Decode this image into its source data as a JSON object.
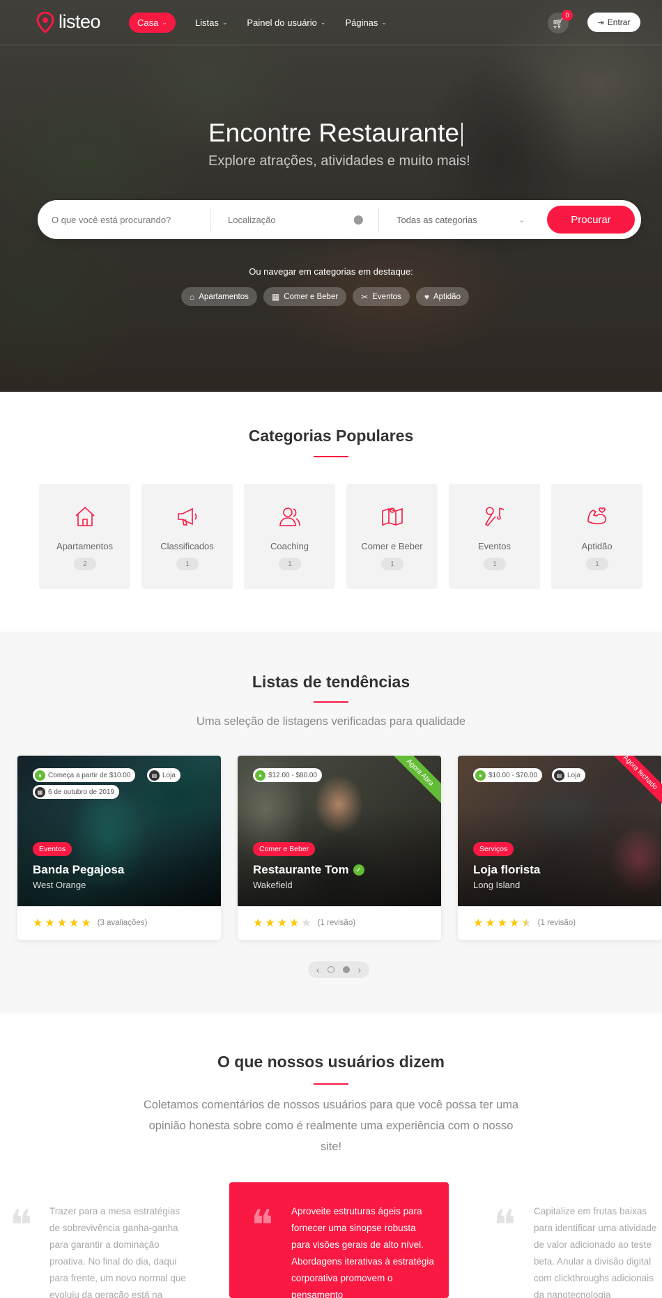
{
  "brand": {
    "name": "listeo",
    "accent": "#f91942"
  },
  "nav": {
    "items": [
      {
        "label": "Casa",
        "active": true
      },
      {
        "label": "Listas",
        "active": false
      },
      {
        "label": "Painel do usuário",
        "active": false
      },
      {
        "label": "Páginas",
        "active": false
      }
    ],
    "cart_count": "0",
    "signin_label": "Entrar"
  },
  "hero": {
    "title": "Encontre Restaurante",
    "subtitle": "Explore atrações, atividades e muito mais!",
    "search": {
      "what_placeholder": "O que você está procurando?",
      "location_placeholder": "Localização",
      "category_value": "Todas as categorias",
      "button_label": "Procurar"
    },
    "browse_label": "Ou navegar em categorias em destaque:",
    "featured": [
      {
        "label": "Apartamentos",
        "icon": "house-icon"
      },
      {
        "label": "Comer e Beber",
        "icon": "food-icon"
      },
      {
        "label": "Eventos",
        "icon": "tools-icon"
      },
      {
        "label": "Aptidão",
        "icon": "fitness-icon"
      }
    ]
  },
  "popular": {
    "title": "Categorias Populares",
    "items": [
      {
        "name": "Apartamentos",
        "count": "2",
        "icon": "house-icon"
      },
      {
        "name": "Classificados",
        "count": "1",
        "icon": "megaphone-icon"
      },
      {
        "name": "Coaching",
        "count": "1",
        "icon": "people-icon"
      },
      {
        "name": "Comer e Beber",
        "count": "1",
        "icon": "map-icon"
      },
      {
        "name": "Eventos",
        "count": "1",
        "icon": "microphone-icon"
      },
      {
        "name": "Aptidão",
        "count": "1",
        "icon": "muscle-icon"
      }
    ]
  },
  "trending": {
    "title": "Listas de tendências",
    "subtitle": "Uma seleção de listagens verificadas para qualidade",
    "cards": [
      {
        "price": "Começa a partir de $10.00",
        "store": "Loja",
        "date": "6 de outubro de 2019",
        "type": "Eventos",
        "title": "Banda Pegajosa",
        "location": "West Orange",
        "rating": 5,
        "reviews": "(3 avaliações)",
        "ribbon": ""
      },
      {
        "price": "$12.00 - $80.00",
        "store": "",
        "date": "",
        "type": "Comer e Beber",
        "title": "Restaurante Tom",
        "location": "Wakefield",
        "rating": 4,
        "reviews": "(1 revisão)",
        "ribbon": "Agora Abra"
      },
      {
        "price": "$10.00 - $70.00",
        "store": "Loja",
        "date": "",
        "type": "Serviços",
        "title": "Loja florista",
        "location": "Long Island",
        "rating": 4.5,
        "reviews": "(1 revisão)",
        "ribbon": "Agora fechado"
      }
    ]
  },
  "testimonials": {
    "title": "O que nossos usuários dizem",
    "subtitle": "Coletamos comentários de nossos usuários para que você possa ter uma opinião honesta sobre como é realmente uma experiência com o nosso site!",
    "items": [
      {
        "text": "Trazer para a mesa estratégias de sobrevivência ganha-ganha para garantir a dominação proativa. No final do dia, daqui para frente, um novo normal que evoluiu da geração está na"
      },
      {
        "text": "Aproveite estruturas ágeis para fornecer uma sinopse robusta para visões gerais de alto nível. Abordagens iterativas à estratégia corporativa promovem o pensamento"
      },
      {
        "text": "Capitalize em frutas baixas para identificar uma atividade de valor adicionado ao teste beta. Anular a divisão digital com clickthroughs adicionais da nanotecnologia"
      }
    ]
  }
}
